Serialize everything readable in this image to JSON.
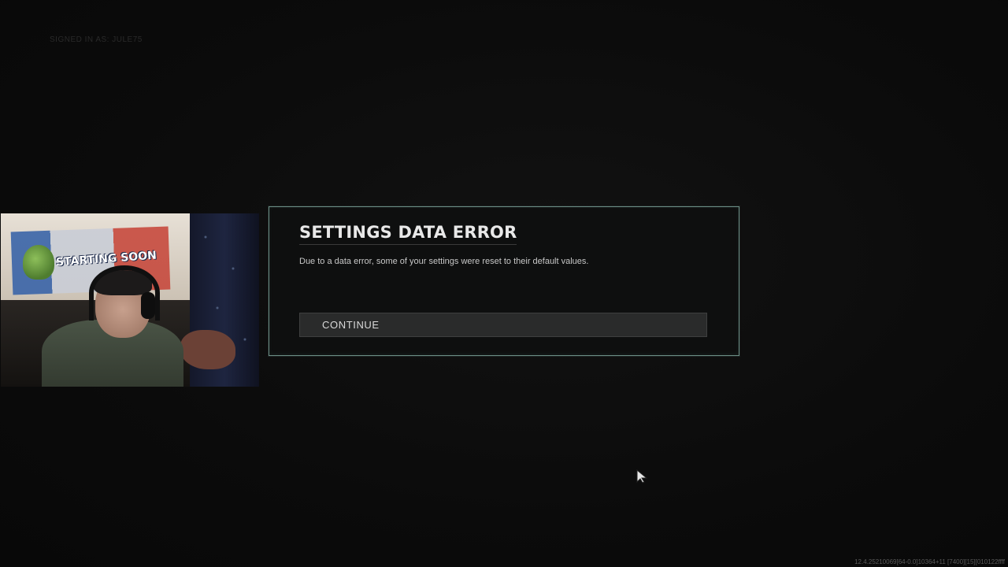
{
  "header": {
    "signed_in": "SIGNED IN AS: JULE75"
  },
  "webcam": {
    "banner_text": "STARTING SOON"
  },
  "dialog": {
    "title": "SETTINGS DATA ERROR",
    "message": "Due to a data error, some of your settings were reset to their default values.",
    "continue_label": "CONTINUE"
  },
  "footer": {
    "build_info": "12.4.25210069[64-0.0]10364+11 [7400][15][010122ffff"
  },
  "colors": {
    "dialog_border": "#6c8e86",
    "background": "#0b0b0b",
    "button_bg": "#2a2b2b"
  },
  "icons": {
    "cursor": "mouse-pointer-icon"
  }
}
